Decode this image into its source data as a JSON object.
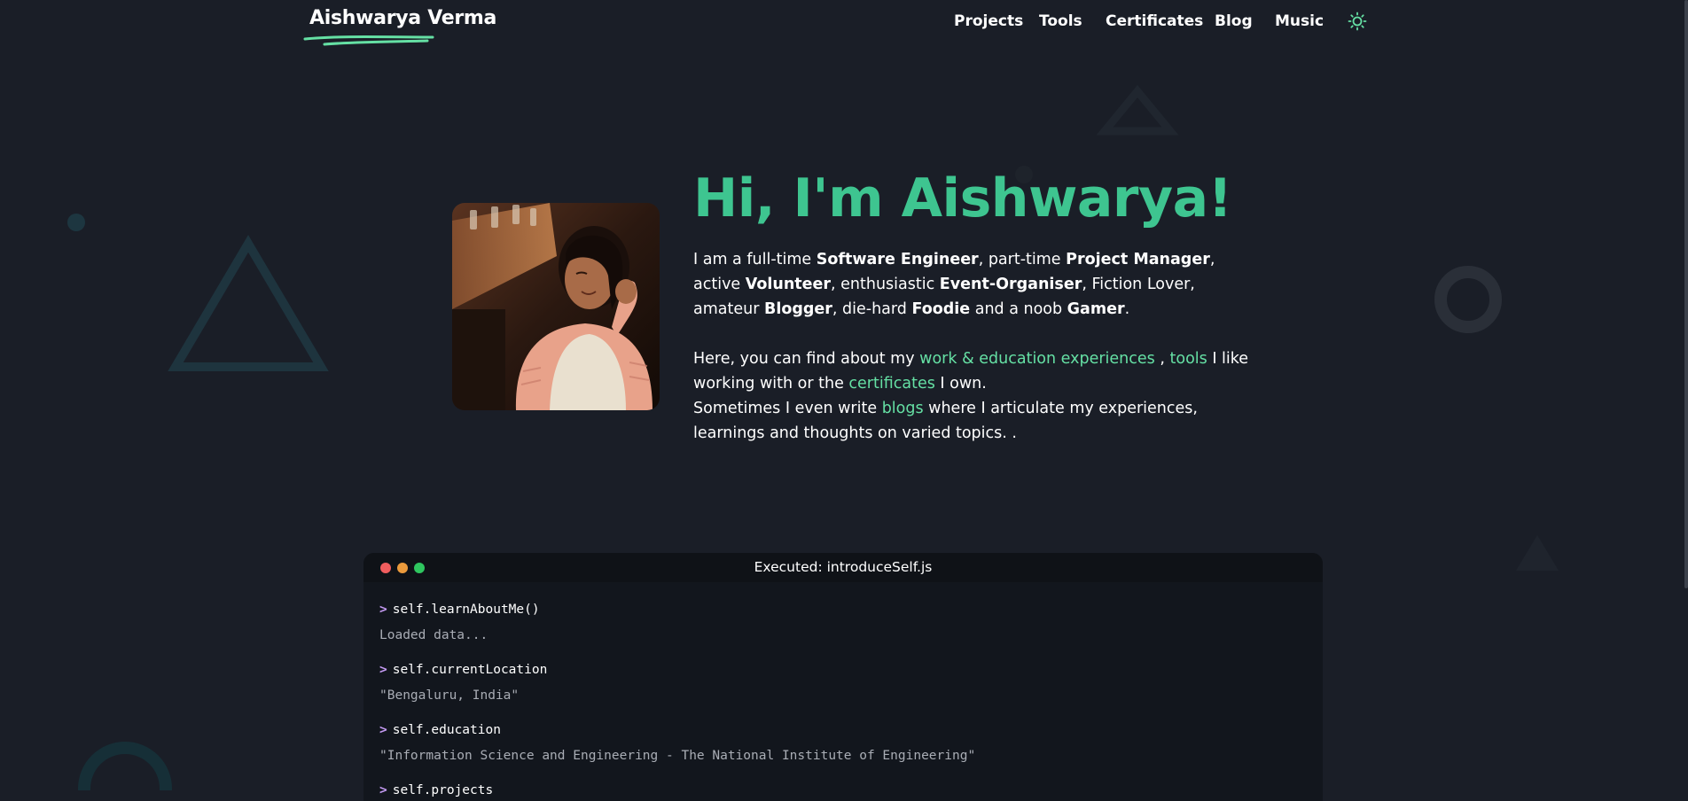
{
  "header": {
    "brand": "Aishwarya Verma",
    "nav": [
      {
        "label": "Projects"
      },
      {
        "label": "Tools"
      },
      {
        "label": "Certificates"
      },
      {
        "label": "Blog"
      },
      {
        "label": "Music"
      }
    ],
    "theme_icon": "sun-icon"
  },
  "hero": {
    "title": "Hi, I'm Aishwarya!",
    "intro": {
      "t1": "I am a full-time ",
      "role1": "Software Engineer",
      "t2": ", part-time ",
      "role2": "Project Manager",
      "t3": ", active ",
      "role3": "Volunteer",
      "t4": ", enthusiastic ",
      "role4": "Event-Organiser",
      "t5": ", Fiction Lover, amateur ",
      "role5": "Blogger",
      "t6": ", die-hard ",
      "role6": "Foodie",
      "t7": " and a noob ",
      "role7": "Gamer",
      "t8": "."
    },
    "find": {
      "t1": "Here, you can find about my ",
      "link_work": "work & education experiences",
      "t2": " , ",
      "link_tools": "tools",
      "t3": " I like working with or the ",
      "link_certificates": "certificates",
      "t4": " I own.",
      "t5": "Sometimes I even write ",
      "link_blogs": "blogs",
      "t6": " where I articulate my experiences, learnings and thoughts on varied topics. ."
    }
  },
  "terminal": {
    "title": "Executed: introduceSelf.js",
    "prompt": ">",
    "entries": [
      {
        "command": "self.learnAboutMe()",
        "output": "Loaded data..."
      },
      {
        "command": "self.currentLocation",
        "output": "\"Bengaluru, India\""
      },
      {
        "command": "self.education",
        "output": "\"Information Science and Engineering - The National Institute of Engineering\""
      },
      {
        "command": "self.projects",
        "output": ""
      }
    ]
  },
  "colors": {
    "background": "#1a1e27",
    "accent": "#3ec590",
    "link": "#65e0a4",
    "prompt": "#c49af2",
    "dot_red": "#f05d5e",
    "dot_yellow": "#eb9a3c",
    "dot_green": "#2fc65f"
  }
}
